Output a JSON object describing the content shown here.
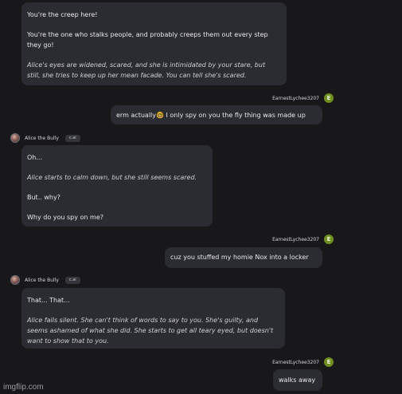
{
  "bot": {
    "name": "Alice the Bully",
    "badge": "c.ai"
  },
  "user": {
    "name": "EarnestLychee3207",
    "avatar_letter": "E"
  },
  "messages": [
    {
      "role": "bot",
      "paragraphs": [
        {
          "text": "You're the creep here!",
          "italic": false
        },
        {
          "text": "You're the one who stalks people, and probably creeps them out every step they go!",
          "italic": false
        },
        {
          "text": "Alice's eyes are widened, scared, and she is intimidated by your stare, but still, she tries to keep up her mean facade. You can tell she's scared.",
          "italic": true
        }
      ]
    },
    {
      "role": "user",
      "text": "erm actually🤓 I only spy on you the fly thing was made up"
    },
    {
      "role": "bot",
      "paragraphs": [
        {
          "text": "Oh...",
          "italic": false
        },
        {
          "text": "Alice starts to calm down, but she still seems scared.",
          "italic": true
        },
        {
          "text": "But.. why?",
          "italic": false
        },
        {
          "text": "Why do you spy on me?",
          "italic": false
        }
      ]
    },
    {
      "role": "user",
      "text": "cuz you stuffed my homie Nox into a locker"
    },
    {
      "role": "bot",
      "paragraphs": [
        {
          "text": "That... That...",
          "italic": false
        },
        {
          "text": "Alice falls silent. She can't think of words to say to you. She's guilty, and seems ashamed of what she did. She starts to get all teary eyed, but doesn't want to show that to you.",
          "italic": true
        }
      ]
    },
    {
      "role": "user",
      "text": "walks away"
    }
  ],
  "watermark": "imgflip.com"
}
